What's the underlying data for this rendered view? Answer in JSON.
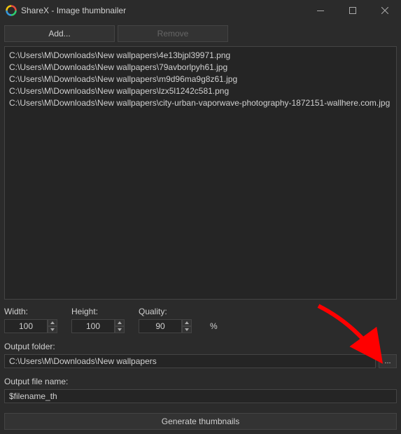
{
  "titlebar": {
    "title": "ShareX - Image thumbnailer"
  },
  "buttons": {
    "add": "Add...",
    "remove": "Remove",
    "generate": "Generate thumbnails",
    "browse": "..."
  },
  "files": [
    "C:\\Users\\M\\Downloads\\New wallpapers\\4e13bjpl39971.png",
    "C:\\Users\\M\\Downloads\\New wallpapers\\79avborlpyh61.jpg",
    "C:\\Users\\M\\Downloads\\New wallpapers\\m9d96ma9g8z61.jpg",
    "C:\\Users\\M\\Downloads\\New wallpapers\\lzx5l1242c581.png",
    "C:\\Users\\M\\Downloads\\New wallpapers\\city-urban-vaporwave-photography-1872151-wallhere.com.jpg"
  ],
  "params": {
    "width_label": "Width:",
    "width_value": "100",
    "height_label": "Height:",
    "height_value": "100",
    "quality_label": "Quality:",
    "quality_value": "90",
    "quality_unit": "%"
  },
  "output_folder": {
    "label": "Output folder:",
    "value": "C:\\Users\\M\\Downloads\\New wallpapers"
  },
  "output_filename": {
    "label": "Output file name:",
    "value": "$filename_th"
  }
}
